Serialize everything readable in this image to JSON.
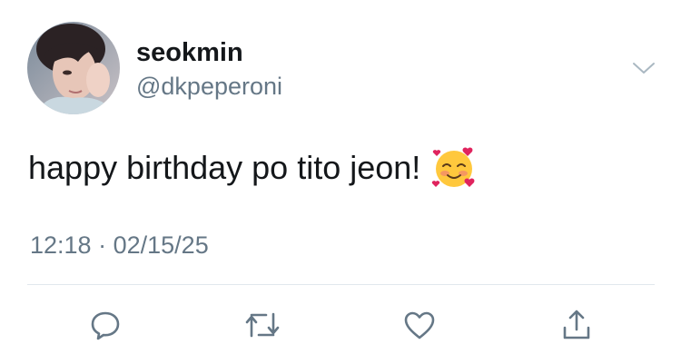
{
  "user": {
    "display_name": "seokmin",
    "handle": "@dkpeperoni"
  },
  "tweet": {
    "text": "happy birthday po tito jeon!",
    "emoji": "smiling-face-with-hearts",
    "time": "12:18",
    "separator": "·",
    "date": "02/15/25"
  },
  "actions": [
    {
      "name": "reply",
      "icon": "reply-icon"
    },
    {
      "name": "retweet",
      "icon": "retweet-icon"
    },
    {
      "name": "like",
      "icon": "heart-icon"
    },
    {
      "name": "share",
      "icon": "share-icon"
    }
  ],
  "colors": {
    "text": "#14171a",
    "secondary_text": "#657786",
    "icon": "#657786",
    "divider": "#e1e8ed",
    "emoji_face": "#ffc83d"
  }
}
